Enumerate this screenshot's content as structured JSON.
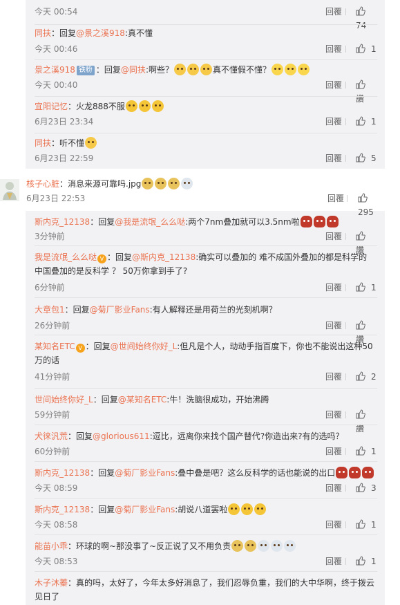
{
  "labels": {
    "reply": "回覆",
    "like_word": "讚"
  },
  "top_thread": [
    {
      "time": "今天 00:54",
      "likes": "74"
    },
    {
      "user": "同扶",
      "text_prefix": "：回复",
      "mention": "@景之溪918",
      "text": ":真不懂",
      "time": "今天 00:46",
      "likes": "1"
    },
    {
      "user": "景之溪918",
      "badge": "铁粉",
      "text_prefix": "：回复",
      "mention": "@同扶",
      "text_a": ":啊些？",
      "text_b": "真不懂假不懂？",
      "time": "今天 00:40",
      "likes": "讚"
    },
    {
      "user": "宜阳记忆",
      "text": "：火龙888不服",
      "time": "6月23日 23:34",
      "likes": "1"
    },
    {
      "user": "同扶",
      "text": "：听不懂",
      "time": "6月23日 22:59",
      "likes": "5"
    }
  ],
  "main_comment": {
    "user": "核子心脏",
    "text": "：消息来源可靠吗.jpg",
    "time": "6月23日 22:53",
    "likes": "295"
  },
  "replies": [
    {
      "user": "斯内克_12138",
      "prefix": "：回复",
      "mention": "@我是流氓_么么哒",
      "text": ":两个7nm叠加就可以3.5nm啦",
      "time": "3分钟前",
      "likes": "讚"
    },
    {
      "user": "我是流氓_么么哒",
      "prefix": "：回复",
      "mention": "@斯内克_12138",
      "text": ":确实可以叠加的 难不成国外叠加的都是科学的 中国叠加的是反科学 ？ 50万你拿到手了?",
      "time": "6分钟前",
      "likes": "1"
    },
    {
      "user": "大章包1",
      "prefix": "：回复",
      "mention": "@菊厂影业Fans",
      "text": ":有人解释还是用荷兰的光刻机啊？",
      "time": "26分钟前",
      "likes": "讚"
    },
    {
      "user": "某知名ETC",
      "prefix": "：回复",
      "mention": "@世间始终你好_L",
      "text": ":但凡是个人，动动手指百度下，你也不能说出这种50万的话",
      "time": "41分钟前",
      "likes": "2"
    },
    {
      "user": "世间始终你好_L",
      "prefix": "：回复",
      "mention": "@某知名ETC",
      "text": ":牛！洗脑很成功，开始沸腾",
      "time": "59分钟前",
      "likes": "讚"
    },
    {
      "user": "犬徕汎荒",
      "prefix": "：回复",
      "mention": "@glorious611",
      "text": ":逗比，远离你来找个国产替代?你造出来?有的选吗？",
      "time": "60分钟前",
      "likes": "1"
    },
    {
      "user": "斯内克_12138",
      "prefix": "：回复",
      "mention": "@菊厂影业Fans",
      "text": ":叠中叠是吧？这么反科学的话也能说的出口",
      "time": "今天 08:59",
      "likes": "3"
    },
    {
      "user": "斯内克_12138",
      "prefix": "：回复",
      "mention": "@菊厂影业Fans",
      "text": ":胡说八道罢啦",
      "time": "今天 08:58",
      "likes": "1"
    },
    {
      "user": "能苗小乖",
      "text": "：环球的啊~那没事了~反正说了又不用负责",
      "time": "今天 08:53",
      "likes": "1"
    },
    {
      "user": "木子沐蓁",
      "text": "：真的吗，太好了，今年太多好消息了，我们忍辱负重，我们的大中华啊，终于拨云见日了"
    }
  ]
}
